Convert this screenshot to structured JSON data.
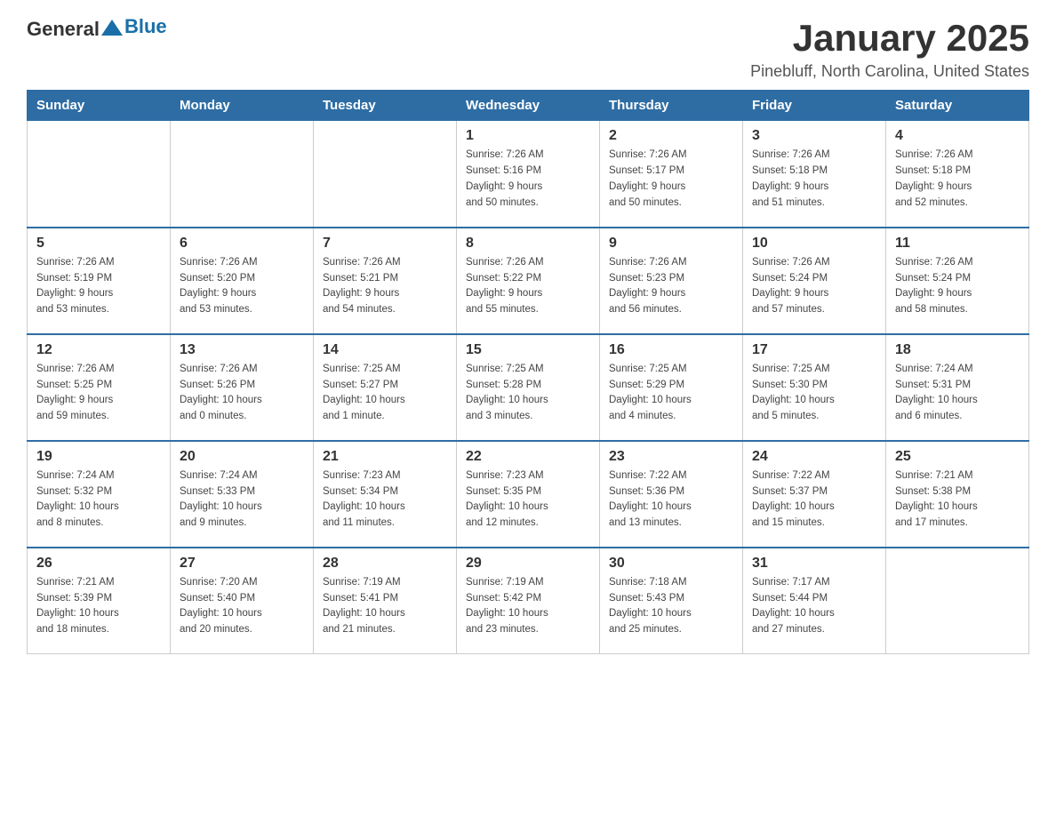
{
  "header": {
    "logo_text_general": "General",
    "logo_text_blue": "Blue",
    "month_title": "January 2025",
    "location": "Pinebluff, North Carolina, United States"
  },
  "weekdays": [
    "Sunday",
    "Monday",
    "Tuesday",
    "Wednesday",
    "Thursday",
    "Friday",
    "Saturday"
  ],
  "weeks": [
    [
      {
        "day": "",
        "info": ""
      },
      {
        "day": "",
        "info": ""
      },
      {
        "day": "",
        "info": ""
      },
      {
        "day": "1",
        "info": "Sunrise: 7:26 AM\nSunset: 5:16 PM\nDaylight: 9 hours\nand 50 minutes."
      },
      {
        "day": "2",
        "info": "Sunrise: 7:26 AM\nSunset: 5:17 PM\nDaylight: 9 hours\nand 50 minutes."
      },
      {
        "day": "3",
        "info": "Sunrise: 7:26 AM\nSunset: 5:18 PM\nDaylight: 9 hours\nand 51 minutes."
      },
      {
        "day": "4",
        "info": "Sunrise: 7:26 AM\nSunset: 5:18 PM\nDaylight: 9 hours\nand 52 minutes."
      }
    ],
    [
      {
        "day": "5",
        "info": "Sunrise: 7:26 AM\nSunset: 5:19 PM\nDaylight: 9 hours\nand 53 minutes."
      },
      {
        "day": "6",
        "info": "Sunrise: 7:26 AM\nSunset: 5:20 PM\nDaylight: 9 hours\nand 53 minutes."
      },
      {
        "day": "7",
        "info": "Sunrise: 7:26 AM\nSunset: 5:21 PM\nDaylight: 9 hours\nand 54 minutes."
      },
      {
        "day": "8",
        "info": "Sunrise: 7:26 AM\nSunset: 5:22 PM\nDaylight: 9 hours\nand 55 minutes."
      },
      {
        "day": "9",
        "info": "Sunrise: 7:26 AM\nSunset: 5:23 PM\nDaylight: 9 hours\nand 56 minutes."
      },
      {
        "day": "10",
        "info": "Sunrise: 7:26 AM\nSunset: 5:24 PM\nDaylight: 9 hours\nand 57 minutes."
      },
      {
        "day": "11",
        "info": "Sunrise: 7:26 AM\nSunset: 5:24 PM\nDaylight: 9 hours\nand 58 minutes."
      }
    ],
    [
      {
        "day": "12",
        "info": "Sunrise: 7:26 AM\nSunset: 5:25 PM\nDaylight: 9 hours\nand 59 minutes."
      },
      {
        "day": "13",
        "info": "Sunrise: 7:26 AM\nSunset: 5:26 PM\nDaylight: 10 hours\nand 0 minutes."
      },
      {
        "day": "14",
        "info": "Sunrise: 7:25 AM\nSunset: 5:27 PM\nDaylight: 10 hours\nand 1 minute."
      },
      {
        "day": "15",
        "info": "Sunrise: 7:25 AM\nSunset: 5:28 PM\nDaylight: 10 hours\nand 3 minutes."
      },
      {
        "day": "16",
        "info": "Sunrise: 7:25 AM\nSunset: 5:29 PM\nDaylight: 10 hours\nand 4 minutes."
      },
      {
        "day": "17",
        "info": "Sunrise: 7:25 AM\nSunset: 5:30 PM\nDaylight: 10 hours\nand 5 minutes."
      },
      {
        "day": "18",
        "info": "Sunrise: 7:24 AM\nSunset: 5:31 PM\nDaylight: 10 hours\nand 6 minutes."
      }
    ],
    [
      {
        "day": "19",
        "info": "Sunrise: 7:24 AM\nSunset: 5:32 PM\nDaylight: 10 hours\nand 8 minutes."
      },
      {
        "day": "20",
        "info": "Sunrise: 7:24 AM\nSunset: 5:33 PM\nDaylight: 10 hours\nand 9 minutes."
      },
      {
        "day": "21",
        "info": "Sunrise: 7:23 AM\nSunset: 5:34 PM\nDaylight: 10 hours\nand 11 minutes."
      },
      {
        "day": "22",
        "info": "Sunrise: 7:23 AM\nSunset: 5:35 PM\nDaylight: 10 hours\nand 12 minutes."
      },
      {
        "day": "23",
        "info": "Sunrise: 7:22 AM\nSunset: 5:36 PM\nDaylight: 10 hours\nand 13 minutes."
      },
      {
        "day": "24",
        "info": "Sunrise: 7:22 AM\nSunset: 5:37 PM\nDaylight: 10 hours\nand 15 minutes."
      },
      {
        "day": "25",
        "info": "Sunrise: 7:21 AM\nSunset: 5:38 PM\nDaylight: 10 hours\nand 17 minutes."
      }
    ],
    [
      {
        "day": "26",
        "info": "Sunrise: 7:21 AM\nSunset: 5:39 PM\nDaylight: 10 hours\nand 18 minutes."
      },
      {
        "day": "27",
        "info": "Sunrise: 7:20 AM\nSunset: 5:40 PM\nDaylight: 10 hours\nand 20 minutes."
      },
      {
        "day": "28",
        "info": "Sunrise: 7:19 AM\nSunset: 5:41 PM\nDaylight: 10 hours\nand 21 minutes."
      },
      {
        "day": "29",
        "info": "Sunrise: 7:19 AM\nSunset: 5:42 PM\nDaylight: 10 hours\nand 23 minutes."
      },
      {
        "day": "30",
        "info": "Sunrise: 7:18 AM\nSunset: 5:43 PM\nDaylight: 10 hours\nand 25 minutes."
      },
      {
        "day": "31",
        "info": "Sunrise: 7:17 AM\nSunset: 5:44 PM\nDaylight: 10 hours\nand 27 minutes."
      },
      {
        "day": "",
        "info": ""
      }
    ]
  ]
}
